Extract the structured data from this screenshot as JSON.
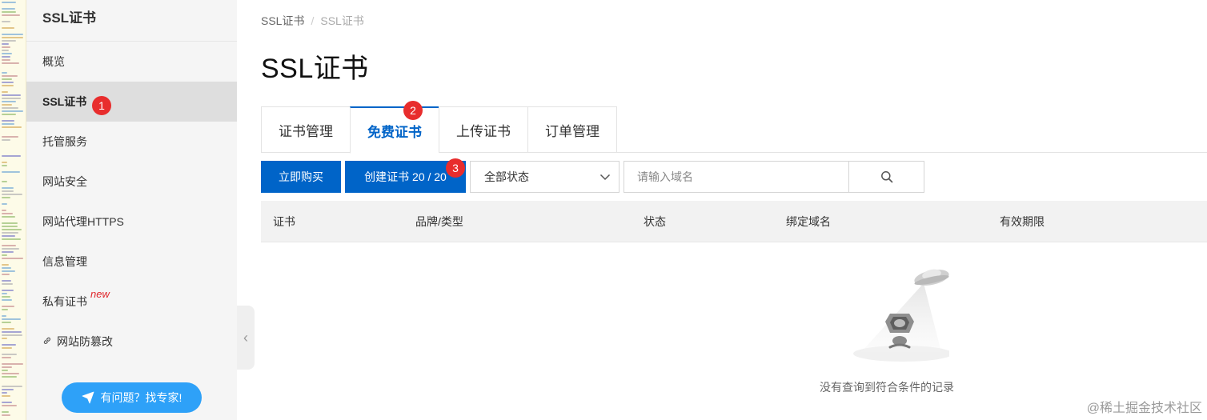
{
  "sidebar": {
    "title": "SSL证书",
    "items": [
      {
        "label": "概览"
      },
      {
        "label": "SSL证书",
        "active": true
      },
      {
        "label": "托管服务"
      },
      {
        "label": "网站安全"
      },
      {
        "label": "网站代理HTTPS"
      },
      {
        "label": "信息管理"
      },
      {
        "label": "私有证书",
        "badge": "new"
      },
      {
        "label": "网站防篡改",
        "icon": "link-icon"
      }
    ],
    "help_button": "有问题？找专家!"
  },
  "breadcrumb": {
    "parent": "SSL证书",
    "current": "SSL证书"
  },
  "page_title": "SSL证书",
  "tabs": [
    {
      "label": "证书管理"
    },
    {
      "label": "免费证书",
      "active": true
    },
    {
      "label": "上传证书"
    },
    {
      "label": "订单管理"
    }
  ],
  "toolbar": {
    "buy_label": "立即购买",
    "create_label": "创建证书 20 / 20",
    "status_select": "全部状态",
    "search_placeholder": "请输入域名"
  },
  "table": {
    "columns": [
      "证书",
      "品牌/类型",
      "状态",
      "绑定域名",
      "有效期限"
    ],
    "empty_text": "没有查询到符合条件的记录"
  },
  "markers": [
    "1",
    "2",
    "3"
  ],
  "watermark": "@稀土掘金技术社区",
  "colors": {
    "primary": "#0064c8",
    "marker": "#e82d2d",
    "help": "#2ea1f8",
    "new_badge": "#e0262b"
  }
}
